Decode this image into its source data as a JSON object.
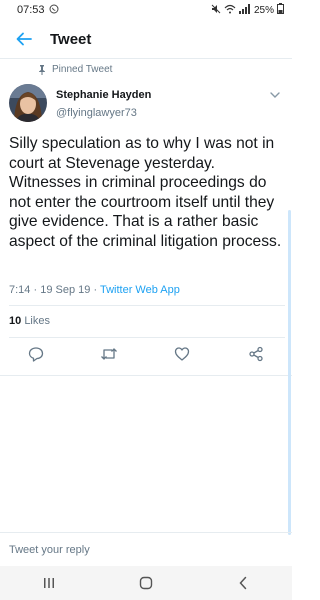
{
  "status_bar": {
    "time": "07:53",
    "battery": "25%"
  },
  "app_bar": {
    "title": "Tweet"
  },
  "tweet": {
    "pinned_label": "Pinned Tweet",
    "author_name": "Stephanie Hayden",
    "author_handle": "@flyinglawyer73",
    "text": "Silly speculation as to why I was not in court at Stevenage yesterday. Witnesses in criminal proceedings do not enter the courtroom itself until they give evidence. That is a rather basic aspect of the criminal litigation process.",
    "time": "7:14",
    "date": "19 Sep 19",
    "source": "Twitter Web App",
    "likes_count": "10",
    "likes_label": "Likes"
  },
  "reply_placeholder": "Tweet your reply",
  "colors": {
    "accent": "#1da1f2",
    "text": "#14171a",
    "muted": "#657786"
  },
  "icons": [
    "back-arrow-icon",
    "pin-icon",
    "chevron-down-icon",
    "reply-icon",
    "retweet-icon",
    "like-icon",
    "share-icon"
  ]
}
